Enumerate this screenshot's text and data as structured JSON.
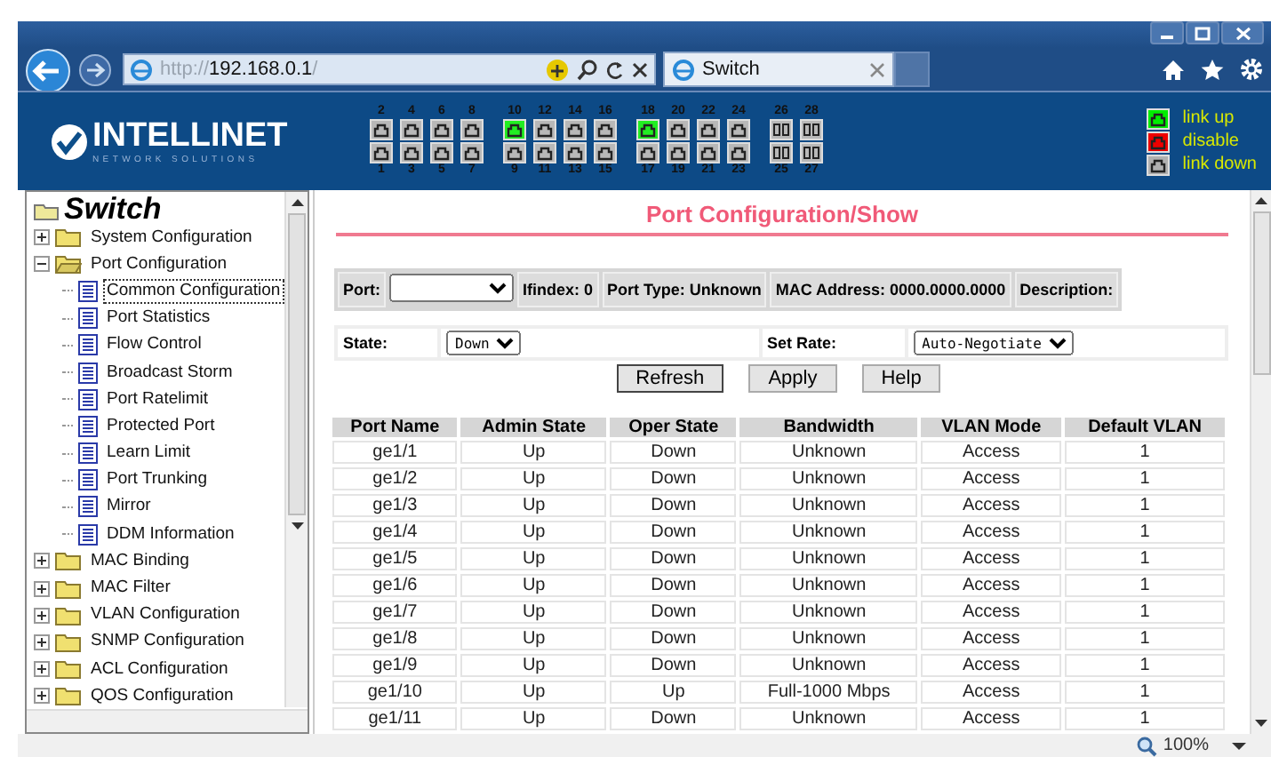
{
  "browser": {
    "url_scheme": "http://",
    "url_host": "192.168.0.1",
    "url_path": "/",
    "tab": {
      "title": "Switch"
    }
  },
  "header": {
    "logo": "INTELLINET",
    "logo_tagline": "NETWORK SOLUTIONS",
    "ports_top": [
      {
        "number": "2",
        "linked": false,
        "kind": "rj45"
      },
      {
        "number": "4",
        "linked": false,
        "kind": "rj45"
      },
      {
        "number": "6",
        "linked": false,
        "kind": "rj45"
      },
      {
        "number": "8",
        "linked": false,
        "kind": "rj45"
      },
      {
        "number": "10",
        "linked": true,
        "kind": "rj45"
      },
      {
        "number": "12",
        "linked": false,
        "kind": "rj45"
      },
      {
        "number": "14",
        "linked": false,
        "kind": "rj45"
      },
      {
        "number": "16",
        "linked": false,
        "kind": "rj45"
      },
      {
        "number": "18",
        "linked": true,
        "kind": "rj45"
      },
      {
        "number": "20",
        "linked": false,
        "kind": "rj45"
      },
      {
        "number": "22",
        "linked": false,
        "kind": "rj45"
      },
      {
        "number": "24",
        "linked": false,
        "kind": "rj45"
      },
      {
        "number": "26",
        "linked": false,
        "kind": "sfp"
      },
      {
        "number": "28",
        "linked": false,
        "kind": "sfp"
      }
    ],
    "ports_bottom": [
      {
        "number": "1",
        "linked": false,
        "kind": "rj45"
      },
      {
        "number": "3",
        "linked": false,
        "kind": "rj45"
      },
      {
        "number": "5",
        "linked": false,
        "kind": "rj45"
      },
      {
        "number": "7",
        "linked": false,
        "kind": "rj45"
      },
      {
        "number": "9",
        "linked": false,
        "kind": "rj45"
      },
      {
        "number": "11",
        "linked": false,
        "kind": "rj45"
      },
      {
        "number": "13",
        "linked": false,
        "kind": "rj45"
      },
      {
        "number": "15",
        "linked": false,
        "kind": "rj45"
      },
      {
        "number": "17",
        "linked": false,
        "kind": "rj45"
      },
      {
        "number": "19",
        "linked": false,
        "kind": "rj45"
      },
      {
        "number": "21",
        "linked": false,
        "kind": "rj45"
      },
      {
        "number": "23",
        "linked": false,
        "kind": "rj45"
      },
      {
        "number": "25",
        "linked": false,
        "kind": "sfp"
      },
      {
        "number": "27",
        "linked": false,
        "kind": "sfp"
      }
    ],
    "legend": [
      {
        "label": "link up",
        "color": "#00ee00"
      },
      {
        "label": "disable",
        "color": "#ee0000"
      },
      {
        "label": "link down",
        "color": "#b0b0b0"
      }
    ]
  },
  "sidebar": {
    "tree": {
      "label": "Switch",
      "children": [
        {
          "label": "System Configuration",
          "kind": "folder",
          "expanded": false,
          "selected": false
        },
        {
          "label": "Port Configuration",
          "kind": "folder",
          "expanded": true,
          "selected": false,
          "children": [
            {
              "label": "Common Configuration",
              "kind": "page",
              "selected": true
            },
            {
              "label": "Port Statistics",
              "kind": "page",
              "selected": false
            },
            {
              "label": "Flow Control",
              "kind": "page",
              "selected": false
            },
            {
              "label": "Broadcast Storm",
              "kind": "page",
              "selected": false
            },
            {
              "label": "Port Ratelimit",
              "kind": "page",
              "selected": false
            },
            {
              "label": "Protected Port",
              "kind": "page",
              "selected": false
            },
            {
              "label": "Learn Limit",
              "kind": "page",
              "selected": false
            },
            {
              "label": "Port Trunking",
              "kind": "page",
              "selected": false
            },
            {
              "label": "Mirror",
              "kind": "page",
              "selected": false
            },
            {
              "label": "DDM Information",
              "kind": "page",
              "selected": false
            }
          ]
        },
        {
          "label": "MAC Binding",
          "kind": "folder",
          "expanded": false,
          "selected": false
        },
        {
          "label": "MAC Filter",
          "kind": "folder",
          "expanded": false,
          "selected": false
        },
        {
          "label": "VLAN Configuration",
          "kind": "folder",
          "expanded": false,
          "selected": false
        },
        {
          "label": "SNMP Configuration",
          "kind": "folder",
          "expanded": false,
          "selected": false
        },
        {
          "label": "ACL Configuration",
          "kind": "folder",
          "expanded": false,
          "selected": false
        },
        {
          "label": "QOS Configuration",
          "kind": "folder",
          "expanded": false,
          "selected": false
        }
      ]
    }
  },
  "main": {
    "title": "Port Configuration/Show",
    "port_label": "Port:",
    "info_cells": [
      "Ifindex: 0",
      "Port Type: Unknown",
      "MAC Address: 0000.0000.0000",
      "Description:"
    ],
    "state_label": "State:",
    "state_value": "Down",
    "rate_label": "Set Rate:",
    "rate_value": "Auto-Negotiate",
    "buttons": [
      {
        "label": "Refresh",
        "focused": true
      },
      {
        "label": "Apply",
        "focused": false
      },
      {
        "label": "Help",
        "focused": false
      }
    ],
    "table": {
      "columns": [
        "Port Name",
        "Admin State",
        "Oper State",
        "Bandwidth",
        "VLAN Mode",
        "Default VLAN"
      ],
      "rows": [
        [
          "ge1/1",
          "Up",
          "Down",
          "Unknown",
          "Access",
          "1"
        ],
        [
          "ge1/2",
          "Up",
          "Down",
          "Unknown",
          "Access",
          "1"
        ],
        [
          "ge1/3",
          "Up",
          "Down",
          "Unknown",
          "Access",
          "1"
        ],
        [
          "ge1/4",
          "Up",
          "Down",
          "Unknown",
          "Access",
          "1"
        ],
        [
          "ge1/5",
          "Up",
          "Down",
          "Unknown",
          "Access",
          "1"
        ],
        [
          "ge1/6",
          "Up",
          "Down",
          "Unknown",
          "Access",
          "1"
        ],
        [
          "ge1/7",
          "Up",
          "Down",
          "Unknown",
          "Access",
          "1"
        ],
        [
          "ge1/8",
          "Up",
          "Down",
          "Unknown",
          "Access",
          "1"
        ],
        [
          "ge1/9",
          "Up",
          "Down",
          "Unknown",
          "Access",
          "1"
        ],
        [
          "ge1/10",
          "Up",
          "Up",
          "Full-1000 Mbps",
          "Access",
          "1"
        ],
        [
          "ge1/11",
          "Up",
          "Down",
          "Unknown",
          "Access",
          "1"
        ]
      ]
    }
  },
  "status_bar": {
    "zoom": "100%"
  }
}
